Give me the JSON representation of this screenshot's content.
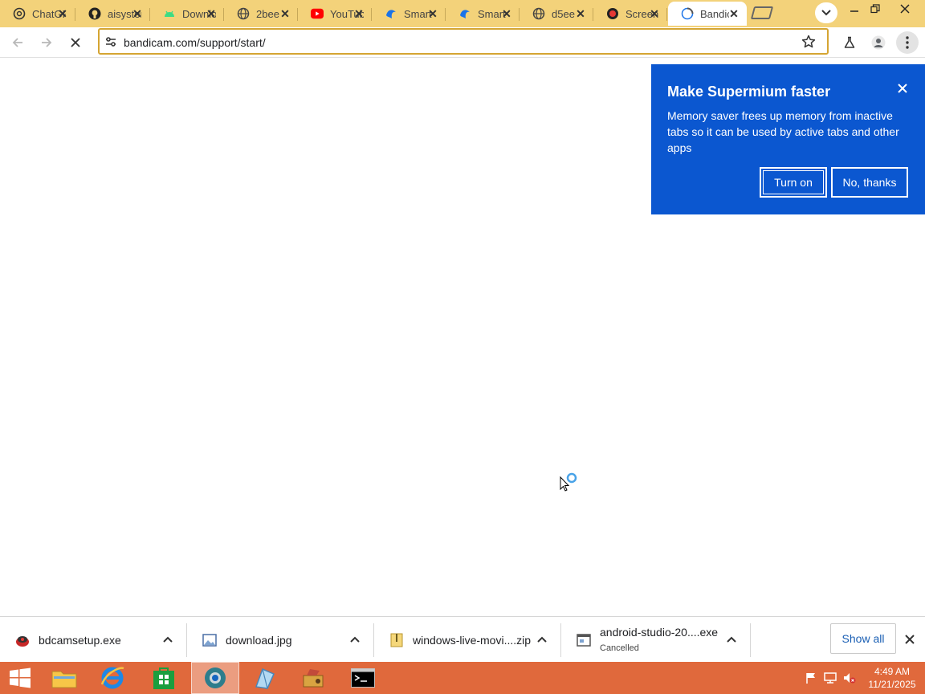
{
  "browser": {
    "tabs": [
      {
        "title": "ChatGPT",
        "icon": "chatgpt-icon"
      },
      {
        "title": "aisystems",
        "icon": "github-icon"
      },
      {
        "title": "Download",
        "icon": "android-icon"
      },
      {
        "title": "2bee",
        "icon": "globe-icon"
      },
      {
        "title": "YouTube",
        "icon": "youtube-icon"
      },
      {
        "title": "Smart",
        "icon": "bird-icon"
      },
      {
        "title": "Smart",
        "icon": "bird-icon"
      },
      {
        "title": "d5ee",
        "icon": "globe-icon"
      },
      {
        "title": "Screen",
        "icon": "record-icon"
      },
      {
        "title": "Bandicam",
        "icon": "loading-globe-icon"
      }
    ],
    "url": "bandicam.com/support/start/"
  },
  "popup": {
    "title": "Make Supermium faster",
    "body": "Memory saver frees up memory from inactive tabs so it can be used by active tabs and other apps",
    "turn_on_label": "Turn on",
    "no_thanks_label": "No, thanks",
    "accent_color": "#0b57d0"
  },
  "downloads": {
    "items": [
      {
        "name": "bdcamsetup.exe",
        "status": "",
        "icon": "bandicam-file-icon"
      },
      {
        "name": "download.jpg",
        "status": "",
        "icon": "image-file-icon"
      },
      {
        "name": "windows-live-movi....zip",
        "status": "",
        "icon": "zip-file-icon"
      },
      {
        "name": "android-studio-20....exe",
        "status": "Cancelled",
        "icon": "exe-file-icon"
      }
    ],
    "show_all_label": "Show all"
  },
  "taskbar": {
    "apps": [
      "start-button",
      "file-explorer",
      "internet-explorer",
      "store",
      "supermium",
      "app-5",
      "app-6",
      "command-prompt"
    ],
    "time": "4:49 AM",
    "date": "11/21/2025",
    "color": "#e0693c"
  }
}
